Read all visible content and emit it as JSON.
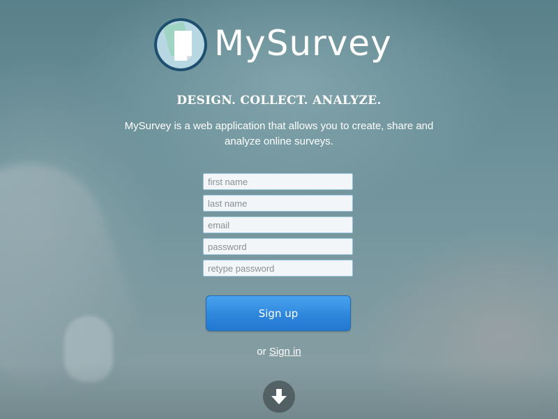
{
  "brand": {
    "name": "MySurvey",
    "badge_colors": {
      "ring": "#1f4f6e",
      "back_card": "#9fd4c3",
      "front_card": "#ffffff"
    }
  },
  "hero": {
    "tagline": "DESIGN. COLLECT. ANALYZE.",
    "description": "MySurvey is a web application that allows you to create, share and analyze online surveys."
  },
  "form": {
    "first_name": {
      "placeholder": "first name",
      "value": ""
    },
    "last_name": {
      "placeholder": "last name",
      "value": ""
    },
    "email": {
      "placeholder": "email",
      "value": ""
    },
    "password": {
      "placeholder": "password",
      "value": ""
    },
    "retype_password": {
      "placeholder": "retype password",
      "value": ""
    },
    "submit_label": "Sign up"
  },
  "signin": {
    "prefix": "or",
    "link_label": "Sign in"
  },
  "scroll": {
    "icon": "arrow-down-icon"
  },
  "colors": {
    "primary_button": "#2f87dc",
    "field_border": "#9dc6e0",
    "text": "#ffffff"
  }
}
